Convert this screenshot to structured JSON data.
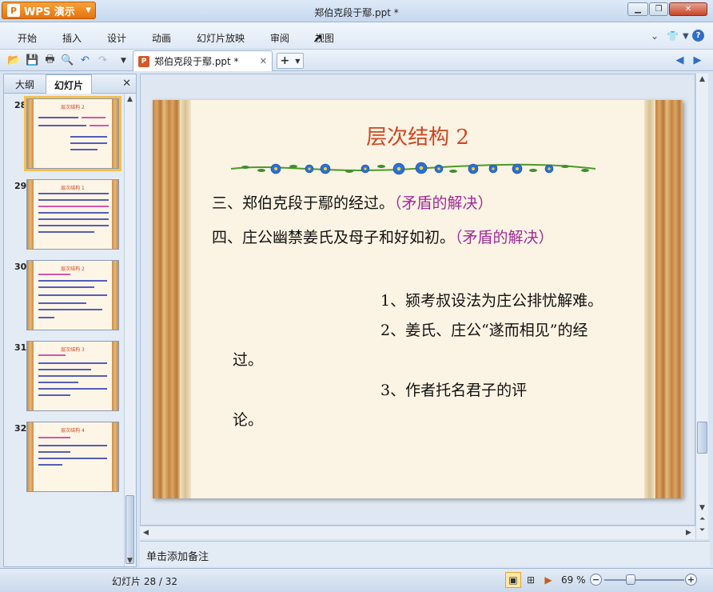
{
  "app": {
    "menu_label": "WPS 演示",
    "logo_glyph": "P",
    "window_title": "郑伯克段于鄢.ppt *"
  },
  "menu": {
    "items": [
      "开始",
      "插入",
      "设计",
      "动画",
      "幻灯片放映",
      "审阅",
      "视图"
    ]
  },
  "toolbar": {
    "doc_tab_label": "郑伯克段于鄢.ppt *",
    "new_tab_label": "+"
  },
  "panel": {
    "tabs": [
      "大纲",
      "幻灯片"
    ],
    "active_tab": "幻灯片",
    "thumbnails": [
      {
        "num": "28",
        "title": "层次结构 2",
        "selected": true
      },
      {
        "num": "29",
        "title": "层次结构 1",
        "selected": false
      },
      {
        "num": "30",
        "title": "层次结构 2",
        "selected": false
      },
      {
        "num": "31",
        "title": "层次结构 3",
        "selected": false
      },
      {
        "num": "32",
        "title": "层次结构 4",
        "selected": false
      }
    ]
  },
  "slide": {
    "title": "层次结构 2",
    "line1": "三、郑伯克段于鄢的经过。",
    "line1_note": "（矛盾的解决）",
    "line2": "四、庄公幽禁姜氏及母子和好如初。",
    "line2_note": "（矛盾的解决）",
    "point1": "1、颍考叔设法为庄公排忧解难。",
    "point2a": "2、姜氏、庄公“遂而相见”的经",
    "point2b": "过。",
    "point3a": "3、作者托名君子的评",
    "point3b": "论。"
  },
  "notes": {
    "placeholder": "单击添加备注"
  },
  "status": {
    "slide_counter": "幻灯片 28 / 32",
    "zoom": "69 %"
  },
  "colors": {
    "title_red": "#d14520",
    "accent_purple": "#a02a9a",
    "wps_orange": "#e5730d"
  }
}
